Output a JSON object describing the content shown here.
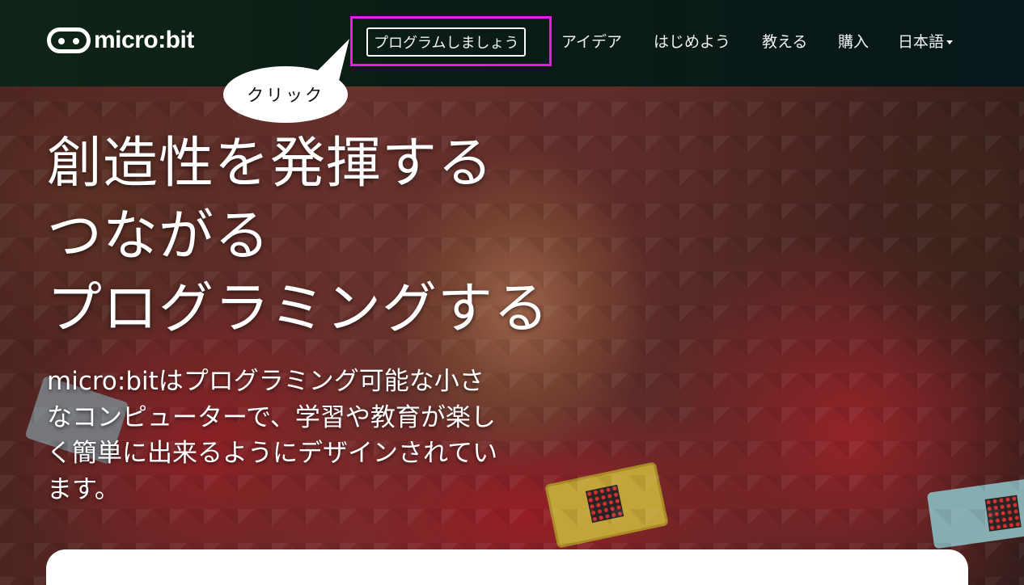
{
  "brand": {
    "logo_text": "micro:bit"
  },
  "nav": {
    "items": [
      {
        "label": "プログラムしましょう"
      },
      {
        "label": "アイデア"
      },
      {
        "label": "はじめよう"
      },
      {
        "label": "教える"
      },
      {
        "label": "購入"
      },
      {
        "label": "日本語"
      }
    ]
  },
  "callout": {
    "text": "クリック"
  },
  "hero": {
    "headline": [
      "創造性を発揮する",
      "つながる",
      "プログラミングする"
    ],
    "subtext": "micro:bitはプログラミング可能な小さなコンピューターで、学習や教育が楽しく簡単に出来るようにデザインされています。"
  },
  "colors": {
    "highlight": "#e81ce6",
    "navbar": "#0b1c14"
  }
}
